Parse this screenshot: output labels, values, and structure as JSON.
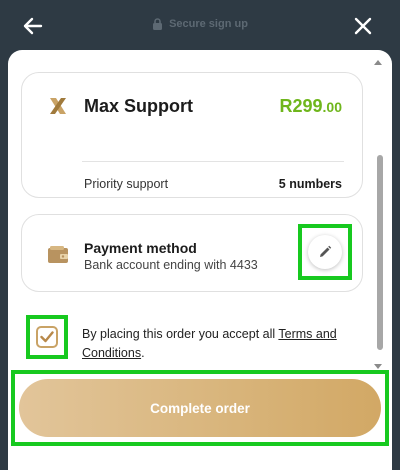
{
  "header": {
    "secure_label": "Secure sign up"
  },
  "plan": {
    "name": "Max Support",
    "price_main": "R299",
    "price_cents": ".00",
    "feature": "Priority support",
    "count": "5 numbers",
    "icon": "x-logo-icon"
  },
  "payment": {
    "title": "Payment method",
    "subtitle": "Bank account ending with 4433",
    "icon": "wallet-icon"
  },
  "terms": {
    "text": "By placing this order you accept all ",
    "link": "Terms and Conditions",
    "suffix": ".",
    "checked": true
  },
  "cta": {
    "label": "Complete order"
  },
  "colors": {
    "background": "#2e3a44",
    "price_green": "#6fb61c",
    "gold": "#c9a366",
    "highlight": "#17c91f"
  }
}
